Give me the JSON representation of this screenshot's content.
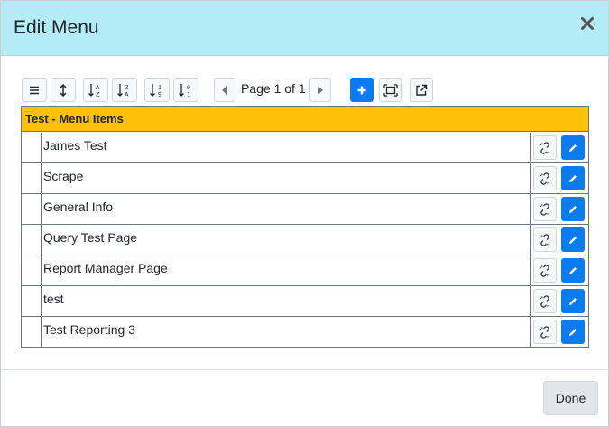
{
  "dialog": {
    "title": "Edit Menu",
    "done_label": "Done"
  },
  "toolbar": {
    "page_label": "Page 1 of 1",
    "buttons": [
      "menu-lines-icon",
      "sort-vertical-icon",
      "sort-alpha-asc-icon",
      "sort-alpha-desc-icon",
      "sort-numeric-asc-icon",
      "sort-numeric-desc-icon",
      "prev-page-icon",
      "next-page-icon",
      "add-icon",
      "fit-frame-icon",
      "external-link-icon"
    ]
  },
  "grid": {
    "header": "Test - Menu Items",
    "rows": [
      "James Test",
      "Scrape",
      "General Info",
      "Query Test Page",
      "Report Manager Page",
      "test",
      "Test Reporting 3"
    ],
    "row_action_icons": [
      "unlink-icon",
      "pencil-icon"
    ]
  },
  "colors": {
    "header_bg": "#b3ecf6",
    "grid_header_bg": "#ffc107",
    "primary": "#0d7bf0"
  }
}
